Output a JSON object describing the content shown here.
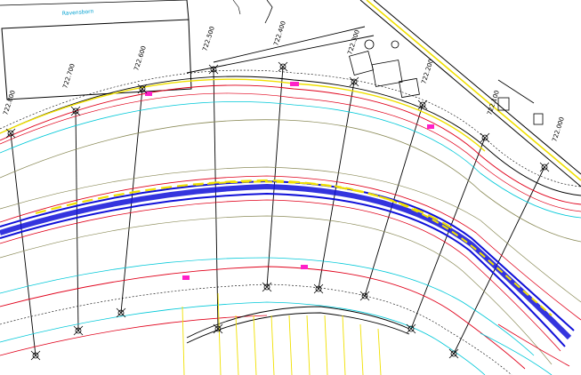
{
  "drawing": {
    "chainage_labels": [
      "722.800",
      "722.700",
      "722.600",
      "722.500",
      "722.400",
      "722.300",
      "722.200",
      "722.100",
      "722.000"
    ],
    "colors": {
      "background": "#ffffff",
      "section_line": "#000000",
      "bank_red": "#e0001a",
      "cyan": "#00c8d8",
      "olive": "#8c8c5a",
      "channel_blue": "#1010d8",
      "shoal_yellow": "#f0e000",
      "pink": "#ff20c8",
      "building": "#000000"
    }
  }
}
